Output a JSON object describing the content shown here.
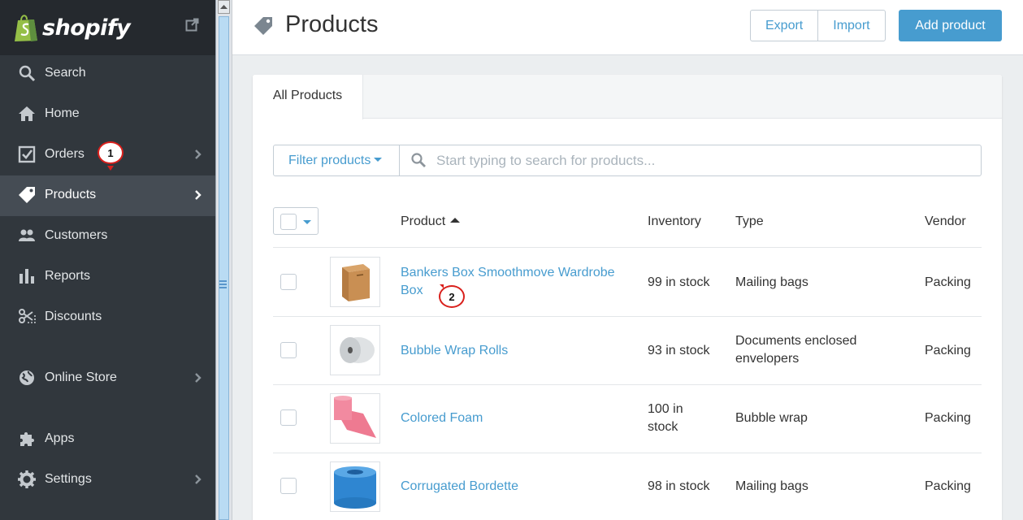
{
  "brand": {
    "name": "shopify"
  },
  "sidebar": {
    "items": [
      {
        "label": "Search",
        "icon": "search-icon"
      },
      {
        "label": "Home",
        "icon": "home-icon"
      },
      {
        "label": "Orders",
        "icon": "orders-icon"
      },
      {
        "label": "Products",
        "icon": "tag-icon"
      },
      {
        "label": "Customers",
        "icon": "customers-icon"
      },
      {
        "label": "Reports",
        "icon": "reports-icon"
      },
      {
        "label": "Discounts",
        "icon": "discounts-icon"
      },
      {
        "label": "Online Store",
        "icon": "globe-icon"
      },
      {
        "label": "Apps",
        "icon": "puzzle-icon"
      },
      {
        "label": "Settings",
        "icon": "gear-icon"
      }
    ],
    "active": "Products"
  },
  "annotations": {
    "step1": "1",
    "step2": "2",
    "color": "#d9201c"
  },
  "header": {
    "title": "Products",
    "export_label": "Export",
    "import_label": "Import",
    "add_label": "Add product"
  },
  "tabs": [
    {
      "label": "All Products"
    }
  ],
  "filter": {
    "button_label": "Filter products",
    "search_placeholder": "Start typing to search for products..."
  },
  "table": {
    "columns": {
      "product": "Product",
      "inventory": "Inventory",
      "type": "Type",
      "vendor": "Vendor"
    },
    "rows": [
      {
        "name": "Bankers Box Smoothmove Wardrobe Box",
        "inventory": "99 in stock",
        "type": "Mailing bags",
        "vendor": "Packing",
        "thumb": "cardboard-box"
      },
      {
        "name": "Bubble Wrap Rolls",
        "inventory": "93 in stock",
        "type": "Documents enclosed envelopers",
        "vendor": "Packing",
        "thumb": "bubble-wrap-roll"
      },
      {
        "name": "Colored Foam",
        "inventory": "100 in stock",
        "type": "Bubble wrap",
        "vendor": "Packing",
        "thumb": "pink-foam-roll"
      },
      {
        "name": "Corrugated Bordette",
        "inventory": "98 in stock",
        "type": "Mailing bags",
        "vendor": "Packing",
        "thumb": "blue-bordette-roll"
      }
    ]
  },
  "colors": {
    "accent": "#479ccf",
    "sidebar_bg": "#31373d",
    "brand_green": "#95bf47"
  }
}
